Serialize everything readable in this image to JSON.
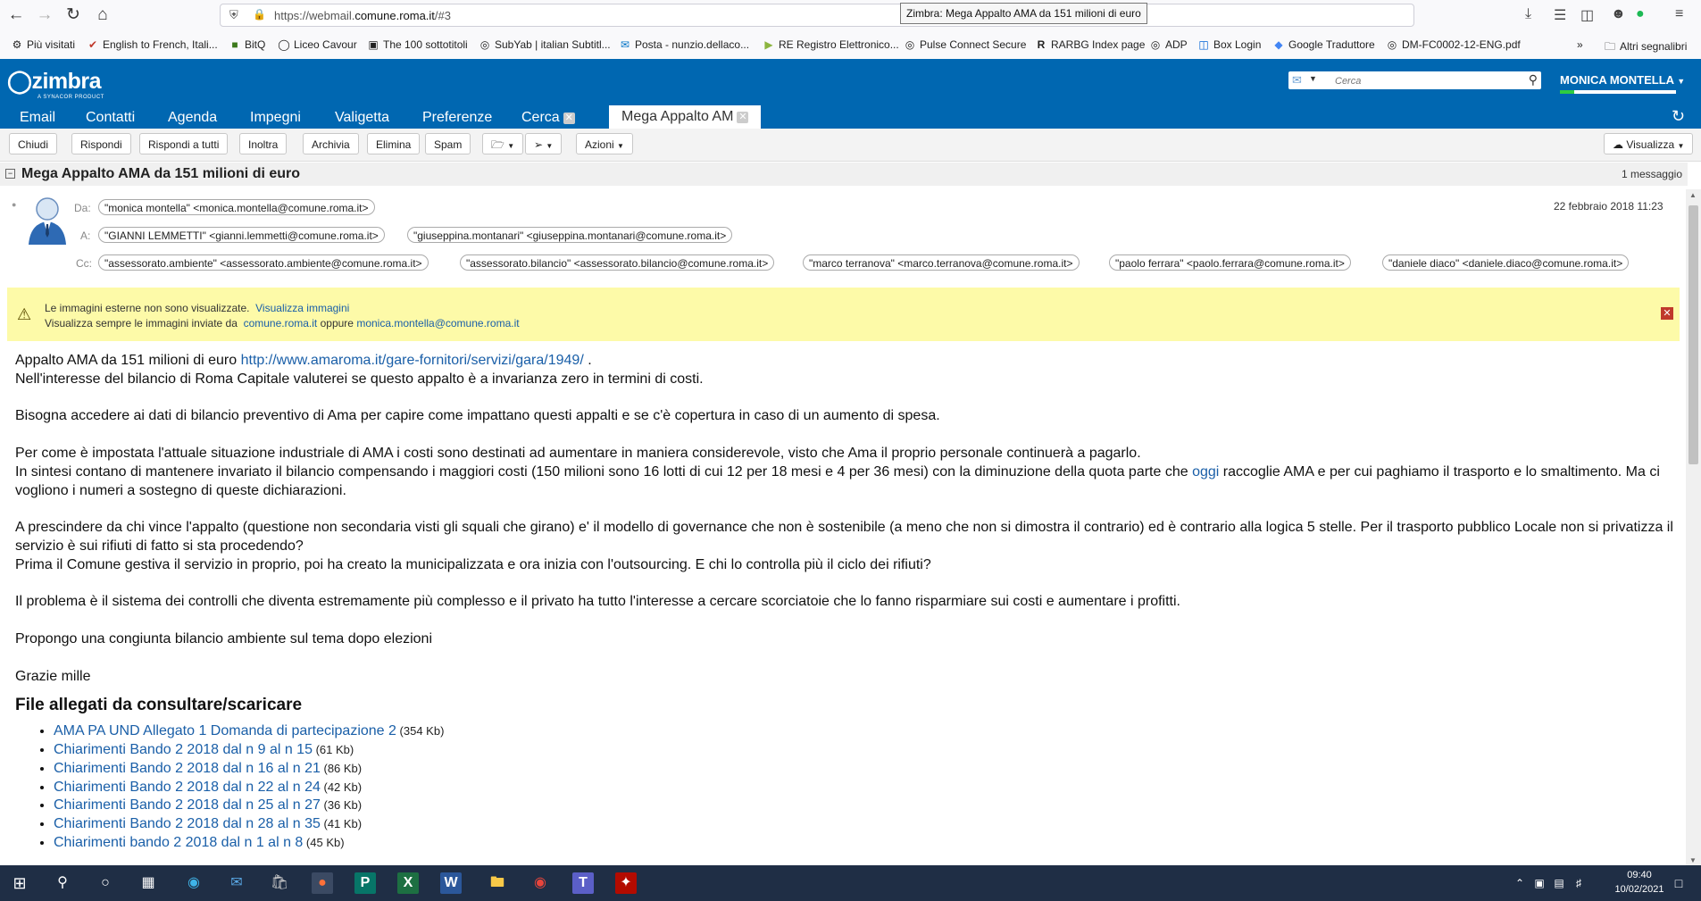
{
  "browser": {
    "url_prefix": "https://webmail.",
    "url_domain": "comune.roma.it",
    "url_suffix": "/#3",
    "tooltip": "Zimbra: Mega Appalto AMA da 151 milioni di euro",
    "bookmarks": [
      "Più visitati",
      "English to French, Itali...",
      "BitQ",
      "Liceo Cavour",
      "The 100 sottotitoli",
      "SubYab | italian Subtitl...",
      "Posta - nunzio.dellaco...",
      "RE Registro Elettronico...",
      "Pulse Connect Secure",
      "RARBG Index page",
      "ADP",
      "Box Login",
      "Google Traduttore",
      "DM-FC0002-12-ENG.pdf"
    ],
    "other_bookmarks": "Altri segnalibri"
  },
  "zimbra": {
    "logo": "zimbra",
    "logo_sub": "A SYNACOR PRODUCT",
    "search_placeholder": "Cerca",
    "user_name": "MONICA MONTELLA",
    "tabs": [
      "Email",
      "Contatti",
      "Agenda",
      "Impegni",
      "Valigetta",
      "Preferenze",
      "Cerca"
    ],
    "active_tab": "Mega Appalto AM",
    "toolbar": {
      "close": "Chiudi",
      "reply": "Rispondi",
      "reply_all": "Rispondi a tutti",
      "forward": "Inoltra",
      "archive": "Archivia",
      "delete": "Elimina",
      "spam": "Spam",
      "actions": "Azioni",
      "view": "Visualizza"
    }
  },
  "message": {
    "subject": "Mega Appalto AMA da 151 milioni di euro",
    "count": "1 messaggio",
    "labels": {
      "from": "Da:",
      "to": "A:",
      "cc": "Cc:"
    },
    "from": "\"monica montella\" <monica.montella@comune.roma.it>",
    "to": [
      "\"GIANNI LEMMETTI\" <gianni.lemmetti@comune.roma.it>",
      "\"giuseppina.montanari\" <giuseppina.montanari@comune.roma.it>"
    ],
    "cc": [
      "\"assessorato.ambiente\" <assessorato.ambiente@comune.roma.it>",
      "\"assessorato.bilancio\" <assessorato.bilancio@comune.roma.it>",
      "\"marco terranova\" <marco.terranova@comune.roma.it>",
      "\"paolo ferrara\" <paolo.ferrara@comune.roma.it>",
      "\"daniele diaco\" <daniele.diaco@comune.roma.it>"
    ],
    "date": "22 febbraio 2018 11:23",
    "warning": {
      "line1": "Le immagini esterne non sono visualizzate.",
      "show_images": "Visualizza immagini",
      "line2": "Visualizza sempre le immagini inviate da",
      "domain": "comune.roma.it",
      "or": "oppure",
      "sender": "monica.montella@comune.roma.it"
    },
    "body": {
      "p1_text": "Appalto AMA da 151 milioni di euro ",
      "p1_link": "http://www.amaroma.it/gare-fornitori/servizi/gara/1949/",
      "p1_end": " .",
      "p2": "Nell'interesse del bilancio di Roma Capitale valuterei se questo appalto è a invarianza zero in termini di costi.",
      "p3": "Bisogna accedere ai dati di bilancio preventivo di Ama per capire come impattano questi appalti e se c'è copertura in caso di un aumento di spesa.",
      "p4": "Per come è impostata l'attuale situazione industriale di AMA i costi sono destinati ad aumentare in maniera considerevole, visto che Ama il proprio personale continuerà a pagarlo.",
      "p5_a": "In sintesi contano di mantenere invariato il bilancio compensando i maggiori costi (150 milioni sono 16 lotti di cui 12 per 18 mesi e 4 per 36 mesi) con la diminuzione della quota parte che ",
      "p5_link": "oggi",
      "p5_b": " raccoglie AMA e per cui paghiamo il trasporto e lo smaltimento. Ma ci vogliono i numeri a sostegno di queste dichiarazioni.",
      "p6": "A prescindere da chi vince l'appalto (questione non secondaria visti gli squali che girano) e' il modello di governance che non è sostenibile (a meno che non si dimostra il contrario) ed è contrario alla logica 5 stelle. Per il trasporto pubblico Locale non si privatizza il servizio è sui rifiuti di fatto si sta procedendo?",
      "p7": "Prima il Comune gestiva il servizio in proprio, poi ha creato la municipalizzata e ora inizia con l'outsourcing. E chi lo controlla più il ciclo dei rifiuti?",
      "p8": "Il problema è il sistema dei controlli che diventa estremamente più complesso e il privato ha tutto l'interesse a cercare scorciatoie che lo fanno risparmiare sui costi e aumentare i profitti.",
      "p9": "Propongo una congiunta bilancio ambiente sul tema dopo elezioni",
      "p10": "Grazie mille",
      "attach_title": "File allegati da consultare/scaricare",
      "attachments": [
        {
          "name": "AMA PA UND Allegato 1 Domanda di partecipazione 2",
          "size": " (354 Kb)"
        },
        {
          "name": "Chiarimenti Bando 2 2018 dal n 9 al n 15",
          "size": " (61 Kb)"
        },
        {
          "name": "Chiarimenti Bando 2 2018 dal n 16 al n 21",
          "size": "  (86 Kb)"
        },
        {
          "name": "Chiarimenti Bando 2 2018 dal n 22 al n 24",
          "size": "  (42 Kb)"
        },
        {
          "name": "Chiarimenti Bando 2 2018 dal n 25 al n 27",
          "size": " (36 Kb)"
        },
        {
          "name": "Chiarimenti Bando 2 2018 dal n 28 al n 35",
          "size": "  (41 Kb)"
        },
        {
          "name": "Chiarimenti bando 2 2018 dal n 1 al n 8",
          "size": " (45 Kb)"
        }
      ]
    }
  },
  "taskbar": {
    "time": "09:40",
    "date": "10/02/2021"
  }
}
